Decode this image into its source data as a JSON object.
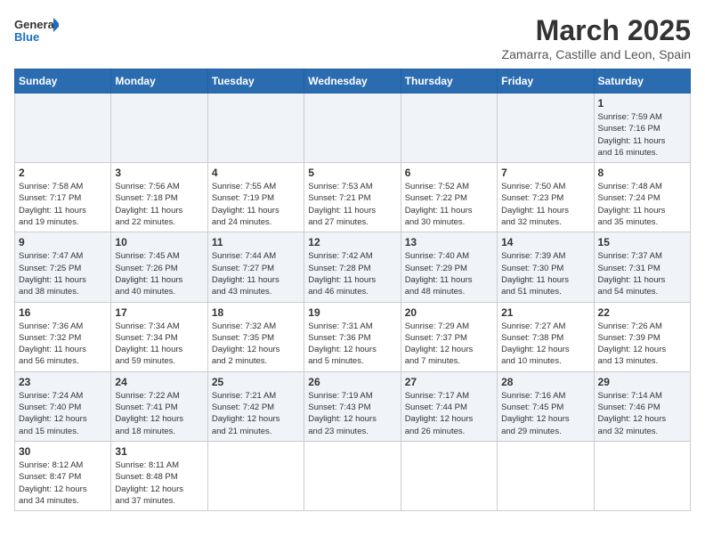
{
  "logo": {
    "text_general": "General",
    "text_blue": "Blue"
  },
  "header": {
    "month_year": "March 2025",
    "location": "Zamarra, Castille and Leon, Spain"
  },
  "weekdays": [
    "Sunday",
    "Monday",
    "Tuesday",
    "Wednesday",
    "Thursday",
    "Friday",
    "Saturday"
  ],
  "weeks": [
    [
      {
        "day": "",
        "info": ""
      },
      {
        "day": "",
        "info": ""
      },
      {
        "day": "",
        "info": ""
      },
      {
        "day": "",
        "info": ""
      },
      {
        "day": "",
        "info": ""
      },
      {
        "day": "",
        "info": ""
      },
      {
        "day": "1",
        "info": "Sunrise: 7:59 AM\nSunset: 7:16 PM\nDaylight: 11 hours\nand 16 minutes."
      }
    ],
    [
      {
        "day": "2",
        "info": "Sunrise: 7:58 AM\nSunset: 7:17 PM\nDaylight: 11 hours\nand 19 minutes."
      },
      {
        "day": "3",
        "info": "Sunrise: 7:56 AM\nSunset: 7:18 PM\nDaylight: 11 hours\nand 22 minutes."
      },
      {
        "day": "4",
        "info": "Sunrise: 7:55 AM\nSunset: 7:19 PM\nDaylight: 11 hours\nand 24 minutes."
      },
      {
        "day": "5",
        "info": "Sunrise: 7:53 AM\nSunset: 7:21 PM\nDaylight: 11 hours\nand 27 minutes."
      },
      {
        "day": "6",
        "info": "Sunrise: 7:52 AM\nSunset: 7:22 PM\nDaylight: 11 hours\nand 30 minutes."
      },
      {
        "day": "7",
        "info": "Sunrise: 7:50 AM\nSunset: 7:23 PM\nDaylight: 11 hours\nand 32 minutes."
      },
      {
        "day": "8",
        "info": "Sunrise: 7:48 AM\nSunset: 7:24 PM\nDaylight: 11 hours\nand 35 minutes."
      }
    ],
    [
      {
        "day": "9",
        "info": "Sunrise: 7:47 AM\nSunset: 7:25 PM\nDaylight: 11 hours\nand 38 minutes."
      },
      {
        "day": "10",
        "info": "Sunrise: 7:45 AM\nSunset: 7:26 PM\nDaylight: 11 hours\nand 40 minutes."
      },
      {
        "day": "11",
        "info": "Sunrise: 7:44 AM\nSunset: 7:27 PM\nDaylight: 11 hours\nand 43 minutes."
      },
      {
        "day": "12",
        "info": "Sunrise: 7:42 AM\nSunset: 7:28 PM\nDaylight: 11 hours\nand 46 minutes."
      },
      {
        "day": "13",
        "info": "Sunrise: 7:40 AM\nSunset: 7:29 PM\nDaylight: 11 hours\nand 48 minutes."
      },
      {
        "day": "14",
        "info": "Sunrise: 7:39 AM\nSunset: 7:30 PM\nDaylight: 11 hours\nand 51 minutes."
      },
      {
        "day": "15",
        "info": "Sunrise: 7:37 AM\nSunset: 7:31 PM\nDaylight: 11 hours\nand 54 minutes."
      }
    ],
    [
      {
        "day": "16",
        "info": "Sunrise: 7:36 AM\nSunset: 7:32 PM\nDaylight: 11 hours\nand 56 minutes."
      },
      {
        "day": "17",
        "info": "Sunrise: 7:34 AM\nSunset: 7:34 PM\nDaylight: 11 hours\nand 59 minutes."
      },
      {
        "day": "18",
        "info": "Sunrise: 7:32 AM\nSunset: 7:35 PM\nDaylight: 12 hours\nand 2 minutes."
      },
      {
        "day": "19",
        "info": "Sunrise: 7:31 AM\nSunset: 7:36 PM\nDaylight: 12 hours\nand 5 minutes."
      },
      {
        "day": "20",
        "info": "Sunrise: 7:29 AM\nSunset: 7:37 PM\nDaylight: 12 hours\nand 7 minutes."
      },
      {
        "day": "21",
        "info": "Sunrise: 7:27 AM\nSunset: 7:38 PM\nDaylight: 12 hours\nand 10 minutes."
      },
      {
        "day": "22",
        "info": "Sunrise: 7:26 AM\nSunset: 7:39 PM\nDaylight: 12 hours\nand 13 minutes."
      }
    ],
    [
      {
        "day": "23",
        "info": "Sunrise: 7:24 AM\nSunset: 7:40 PM\nDaylight: 12 hours\nand 15 minutes."
      },
      {
        "day": "24",
        "info": "Sunrise: 7:22 AM\nSunset: 7:41 PM\nDaylight: 12 hours\nand 18 minutes."
      },
      {
        "day": "25",
        "info": "Sunrise: 7:21 AM\nSunset: 7:42 PM\nDaylight: 12 hours\nand 21 minutes."
      },
      {
        "day": "26",
        "info": "Sunrise: 7:19 AM\nSunset: 7:43 PM\nDaylight: 12 hours\nand 23 minutes."
      },
      {
        "day": "27",
        "info": "Sunrise: 7:17 AM\nSunset: 7:44 PM\nDaylight: 12 hours\nand 26 minutes."
      },
      {
        "day": "28",
        "info": "Sunrise: 7:16 AM\nSunset: 7:45 PM\nDaylight: 12 hours\nand 29 minutes."
      },
      {
        "day": "29",
        "info": "Sunrise: 7:14 AM\nSunset: 7:46 PM\nDaylight: 12 hours\nand 32 minutes."
      }
    ],
    [
      {
        "day": "30",
        "info": "Sunrise: 8:12 AM\nSunset: 8:47 PM\nDaylight: 12 hours\nand 34 minutes."
      },
      {
        "day": "31",
        "info": "Sunrise: 8:11 AM\nSunset: 8:48 PM\nDaylight: 12 hours\nand 37 minutes."
      },
      {
        "day": "",
        "info": ""
      },
      {
        "day": "",
        "info": ""
      },
      {
        "day": "",
        "info": ""
      },
      {
        "day": "",
        "info": ""
      },
      {
        "day": "",
        "info": ""
      }
    ]
  ]
}
